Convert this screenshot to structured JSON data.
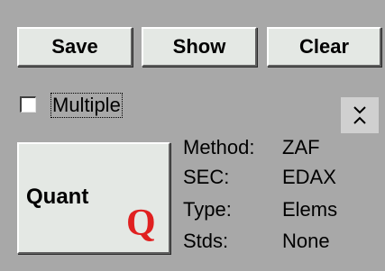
{
  "buttons": {
    "save": "Save",
    "show": "Show",
    "clear": "Clear",
    "quant": "Quant"
  },
  "multiple": {
    "label": "Multiple",
    "checked": false
  },
  "quant_icon": {
    "glyph": "Q",
    "color": "#e02020"
  },
  "settings": [
    {
      "label": "Method:",
      "value": "ZAF"
    },
    {
      "label": "SEC:",
      "value": "EDAX"
    },
    {
      "label": "Type:",
      "value": "Elems"
    },
    {
      "label": "Stds:",
      "value": "None"
    }
  ],
  "icons": {
    "collapse": "collapse-chevron-icon"
  },
  "colors": {
    "panel_background": "#a8a8a8",
    "button_face": "#e4e8e4"
  }
}
